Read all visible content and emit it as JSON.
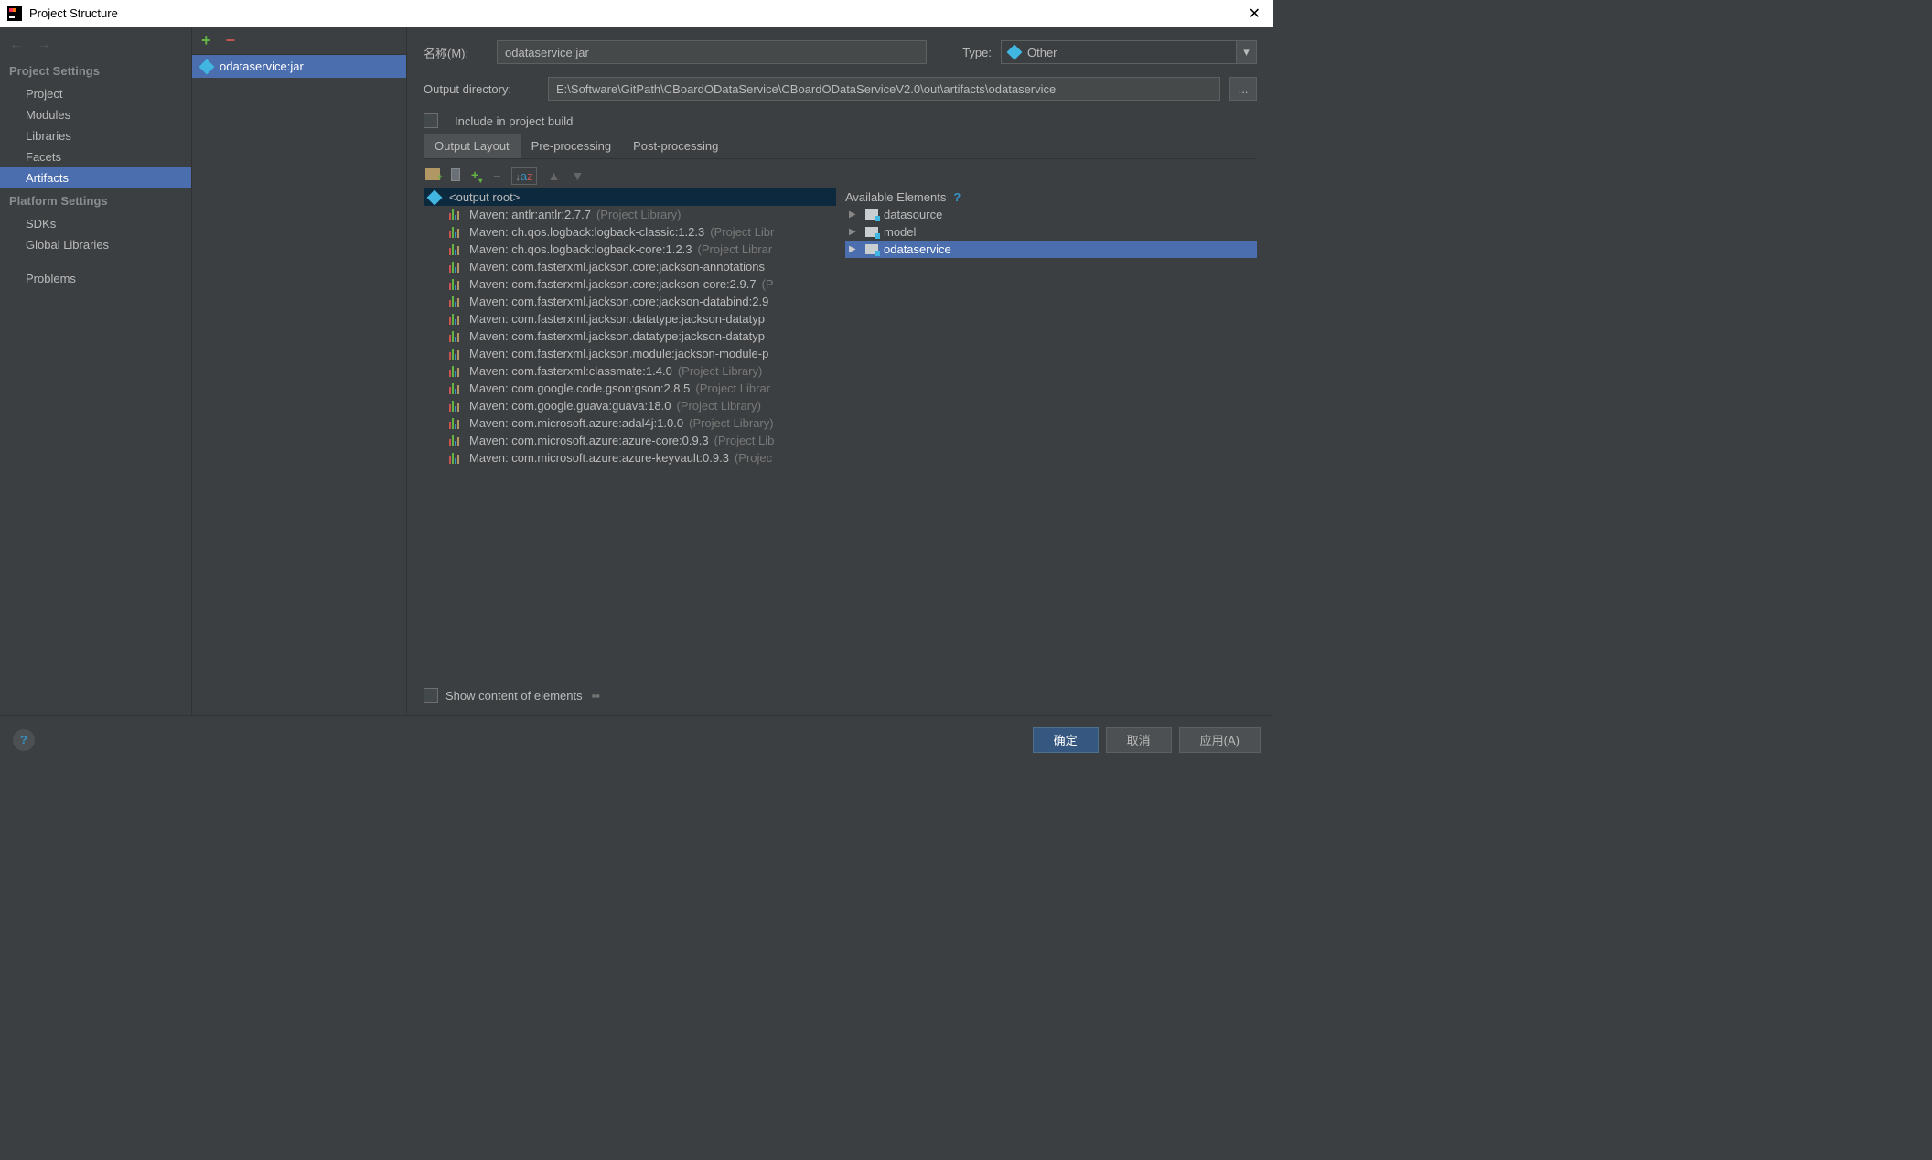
{
  "window": {
    "title": "Project Structure"
  },
  "sidebar": {
    "section1": "Project Settings",
    "items1": [
      "Project",
      "Modules",
      "Libraries",
      "Facets",
      "Artifacts"
    ],
    "section2": "Platform Settings",
    "items2": [
      "SDKs",
      "Global Libraries"
    ],
    "problems": "Problems"
  },
  "artifactsList": {
    "selected": "odataservice:jar"
  },
  "detail": {
    "nameLabel": "名称(M):",
    "nameValue": "odataservice:jar",
    "typeLabel": "Type:",
    "typeValue": "Other",
    "outDirLabel": "Output directory:",
    "outDirValue": "E:\\Software\\GitPath\\CBoardODataService\\CBoardODataServiceV2.0\\out\\artifacts\\odataservice",
    "browse": "...",
    "includeBuild": "Include in project build",
    "tabs": [
      "Output Layout",
      "Pre-processing",
      "Post-processing"
    ],
    "root": "<output root>",
    "libs": [
      {
        "t": "Maven: antlr:antlr:2.7.7",
        "h": "(Project Library)"
      },
      {
        "t": "Maven: ch.qos.logback:logback-classic:1.2.3",
        "h": "(Project Libr"
      },
      {
        "t": "Maven: ch.qos.logback:logback-core:1.2.3",
        "h": "(Project Librar"
      },
      {
        "t": "Maven: com.fasterxml.jackson.core:jackson-annotations",
        "h": ""
      },
      {
        "t": "Maven: com.fasterxml.jackson.core:jackson-core:2.9.7",
        "h": "(P"
      },
      {
        "t": "Maven: com.fasterxml.jackson.core:jackson-databind:2.9",
        "h": ""
      },
      {
        "t": "Maven: com.fasterxml.jackson.datatype:jackson-datatyp",
        "h": ""
      },
      {
        "t": "Maven: com.fasterxml.jackson.datatype:jackson-datatyp",
        "h": ""
      },
      {
        "t": "Maven: com.fasterxml.jackson.module:jackson-module-p",
        "h": ""
      },
      {
        "t": "Maven: com.fasterxml:classmate:1.4.0",
        "h": "(Project Library)"
      },
      {
        "t": "Maven: com.google.code.gson:gson:2.8.5",
        "h": "(Project Librar"
      },
      {
        "t": "Maven: com.google.guava:guava:18.0",
        "h": "(Project Library)"
      },
      {
        "t": "Maven: com.microsoft.azure:adal4j:1.0.0",
        "h": "(Project Library)"
      },
      {
        "t": "Maven: com.microsoft.azure:azure-core:0.9.3",
        "h": "(Project Lib"
      },
      {
        "t": "Maven: com.microsoft.azure:azure-keyvault:0.9.3",
        "h": "(Projec"
      }
    ],
    "availHeader": "Available Elements",
    "avail": [
      "datasource",
      "model",
      "odataservice"
    ],
    "showContent": "Show content of elements"
  },
  "buttons": {
    "ok": "确定",
    "cancel": "取消",
    "apply": "应用(A)"
  }
}
